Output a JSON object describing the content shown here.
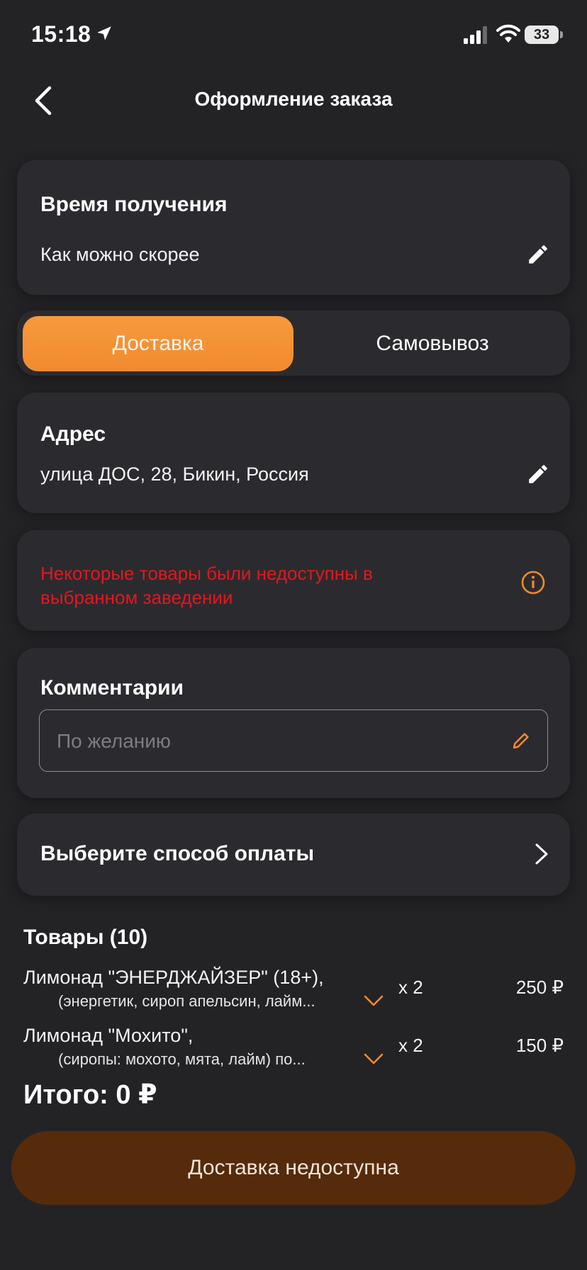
{
  "status_bar": {
    "time": "15:18",
    "battery": "33",
    "icons": [
      "location-arrow-icon",
      "cellular-signal-icon",
      "wifi-icon",
      "battery-icon"
    ]
  },
  "header": {
    "title": "Оформление заказа",
    "back_icon": "chevron-left-icon"
  },
  "pickup_time": {
    "title": "Время получения",
    "value": "Как можно скорее",
    "icon": "pencil-icon"
  },
  "delivery_mode": {
    "options": [
      "Доставка",
      "Самовывоз"
    ],
    "selected": "Доставка"
  },
  "address": {
    "title": "Адрес",
    "value": "улица ДОС, 28, Бикин, Россия",
    "icon": "pencil-icon"
  },
  "warning": {
    "text": "Некоторые товары были недоступны в выбранном заведении",
    "icon": "info-icon"
  },
  "comments": {
    "title": "Комментарии",
    "placeholder": "По желанию",
    "value": ""
  },
  "payment": {
    "label": "Выберите способ оплаты",
    "icon": "chevron-right-icon"
  },
  "items": {
    "title": "Товары (10)",
    "list": [
      {
        "name": "Лимонад \"ЭНЕРДЖАЙЗЕР\" (18+),",
        "modifiers": "(энергетик, сироп апельсин, лайм...",
        "qty": "x 2",
        "price": "250 ₽"
      },
      {
        "name": "Лимонад \"Мохито\",",
        "modifiers": "(сиропы: мохото, мята, лайм) по...",
        "qty": "x 2",
        "price": "150 ₽"
      }
    ]
  },
  "total": "Итого: 0 ₽",
  "submit_button": "Доставка недоступна",
  "colors": {
    "background": "#232326",
    "card": "#2b2b2f",
    "accent": "#f28a2f",
    "warning": "#e5161e",
    "submit_disabled": "#552b0c"
  }
}
